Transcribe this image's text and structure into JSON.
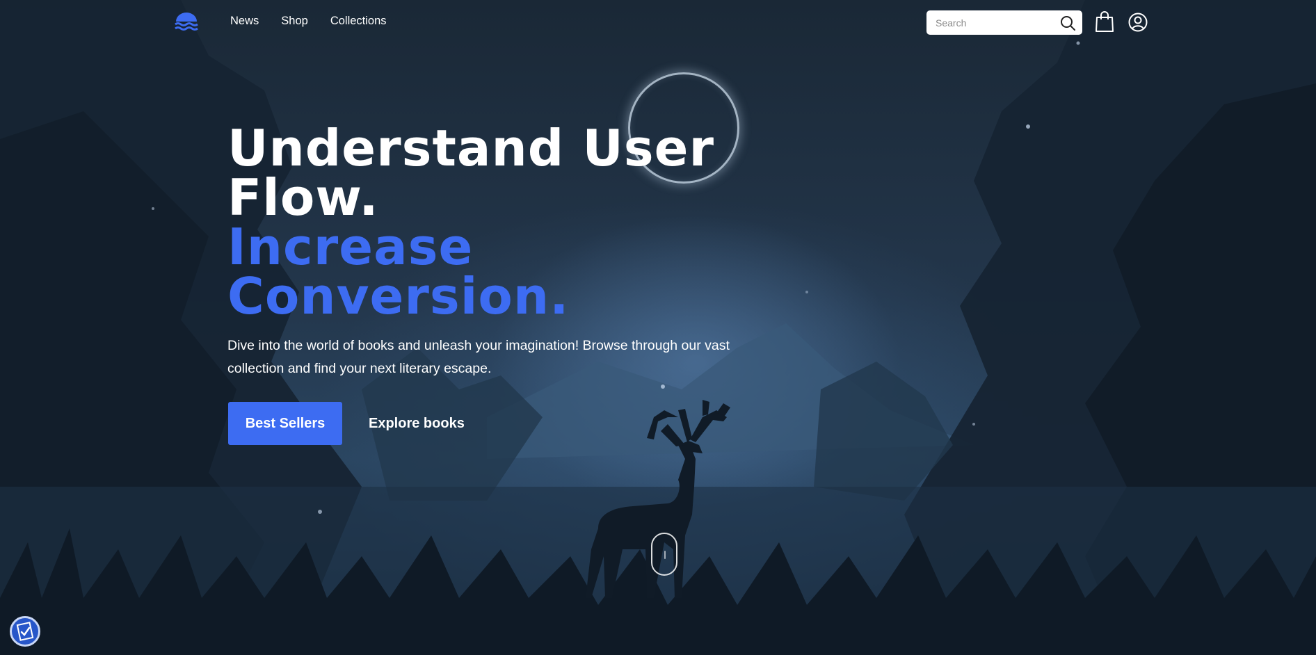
{
  "nav": {
    "logo_icon": "waves-logo-icon",
    "links": [
      {
        "label": "News"
      },
      {
        "label": "Shop"
      },
      {
        "label": "Collections"
      }
    ],
    "search": {
      "placeholder": "Search",
      "value": "",
      "icon": "search-icon"
    },
    "cart_icon": "shopping-bag-icon",
    "account_icon": "user-circle-icon"
  },
  "hero": {
    "headline_line1": "Understand User",
    "headline_line2": "Flow.",
    "headline_line3": "Increase",
    "headline_line4": "Conversion.",
    "subtext": "Dive into the world of books and unleash your imagination! Browse through our vast collection and find your next literary escape.",
    "primary_button": "Best Sellers",
    "secondary_button": "Explore books",
    "scroll_icon": "mouse-scroll-icon"
  },
  "accessibility": {
    "icon": "accessibility-check-icon"
  },
  "colors": {
    "accent": "#3d6cf2",
    "headline_white": "#ffffff",
    "background_dark": "#1b2a3d"
  }
}
